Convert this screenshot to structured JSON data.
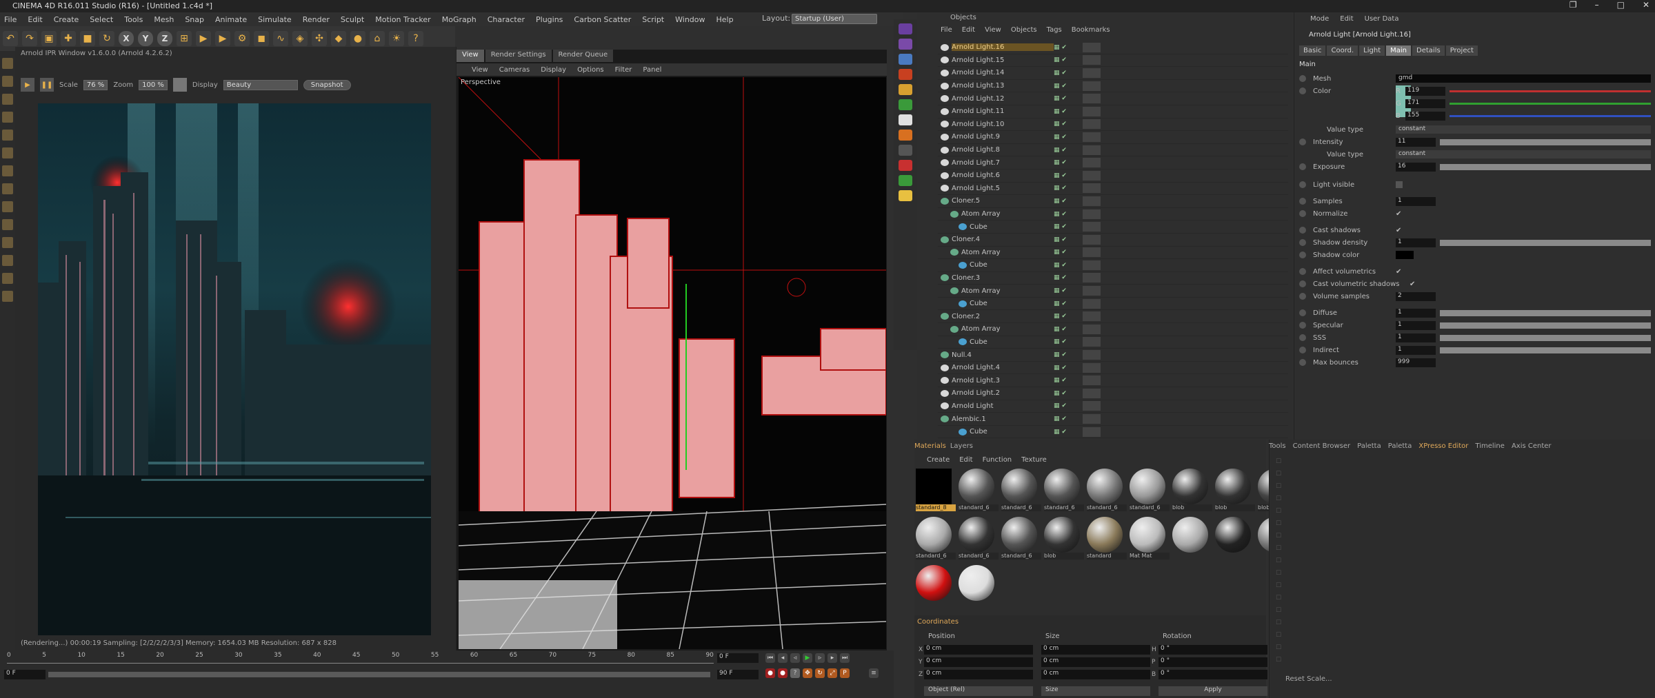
{
  "title": "CINEMA 4D R16.011 Studio (R16) - [Untitled 1.c4d *]",
  "menu": [
    "File",
    "Edit",
    "Create",
    "Select",
    "Tools",
    "Mesh",
    "Snap",
    "Animate",
    "Simulate",
    "Render",
    "Sculpt",
    "Motion Tracker",
    "MoGraph",
    "Character",
    "Plugins",
    "Carbon Scatter",
    "Script",
    "Window",
    "Help"
  ],
  "layout": {
    "label": "Layout:",
    "value": "Startup (User)"
  },
  "ipr": {
    "title": "Arnold IPR Window v1.6.0.0 (Arnold 4.2.6.2)",
    "scale_label": "Scale",
    "scale": "76 %",
    "zoom_label": "Zoom",
    "zoom": "100 %",
    "display_label": "Display",
    "display": "Beauty",
    "snapshot": "Snapshot",
    "status": "(Rendering...) 00:00:19   Sampling: [2/2/2/2/3/3]   Memory: 1654.03 MB   Resolution: 687 x 828"
  },
  "viewport": {
    "tabs": [
      "View",
      "Render Settings",
      "Render Queue"
    ],
    "menu": [
      "View",
      "Cameras",
      "Display",
      "Options",
      "Filter",
      "Panel"
    ],
    "label": "Perspective"
  },
  "objects": {
    "title": "Objects",
    "menu": [
      "File",
      "Edit",
      "View",
      "Objects",
      "Tags",
      "Bookmarks"
    ],
    "rows": [
      "Arnold Light.16",
      "Arnold Light.15",
      "Arnold Light.14",
      "Arnold Light.13",
      "Arnold Light.12",
      "Arnold Light.11",
      "Arnold Light.10",
      "Arnold Light.9",
      "Arnold Light.8",
      "Arnold Light.7",
      "Arnold Light.6",
      "Arnold Light.5",
      "Cloner.5",
      "Atom Array",
      "Cube",
      "Cloner.4",
      "Atom Array",
      "Cube",
      "Cloner.3",
      "Atom Array",
      "Cube",
      "Cloner.2",
      "Atom Array",
      "Cube",
      "Null.4",
      "Arnold Light.4",
      "Arnold Light.3",
      "Arnold Light.2",
      "Arnold Light",
      "Alembic.1",
      "Cube"
    ]
  },
  "attributes": {
    "menu": [
      "Mode",
      "Edit",
      "User Data"
    ],
    "title": "Arnold Light [Arnold Light.16]",
    "tabs": [
      "Basic",
      "Coord.",
      "Light",
      "Main",
      "Details",
      "Project"
    ],
    "section": "Main",
    "mesh_label": "Mesh",
    "mesh_value": "gmd",
    "color_label": "Color",
    "color_swatch": "#7fbfb0",
    "rgb": [
      {
        "k": "R",
        "v": "119"
      },
      {
        "k": "G",
        "v": "171"
      },
      {
        "k": "B",
        "v": "155"
      }
    ],
    "value_type_label": "Value type",
    "value_type": "constant",
    "intensity_label": "Intensity",
    "intensity": "11",
    "exposure_label": "Exposure",
    "exposure": "16",
    "light_visible": "Light visible",
    "samples_label": "Samples",
    "samples": "1",
    "normalize": "Normalize",
    "cast_shadows": "Cast shadows",
    "shadow_density_label": "Shadow density",
    "shadow_density": "1",
    "shadow_color": "Shadow color",
    "affect_vol": "Affect volumetrics",
    "cast_vol_shadows": "Cast volumetric shadows",
    "vol_samples_label": "Volume samples",
    "vol_samples": "2",
    "diffuse_label": "Diffuse",
    "diffuse": "1",
    "specular_label": "Specular",
    "specular": "1",
    "sss_label": "SSS",
    "sss": "1",
    "indirect_label": "Indirect",
    "indirect": "1",
    "max_bounces_label": "Max bounces",
    "max_bounces": "999"
  },
  "materials": {
    "tabs": [
      "Materials",
      "Layers"
    ],
    "menu": [
      "Create",
      "Edit",
      "Function",
      "Texture"
    ],
    "items": [
      "standard_8",
      "standard_6",
      "standard_6",
      "standard_6",
      "standard_6",
      "standard_6",
      "blob",
      "blob",
      "blob.1",
      "standard_6",
      "standard_6",
      "standard_6",
      "blob",
      "standard",
      "Mat Mat",
      "",
      "",
      "",
      "",
      ""
    ]
  },
  "coordinates": {
    "title": "Coordinates",
    "cols": [
      "Position",
      "Size",
      "Rotation"
    ],
    "pos": [
      "0 cm",
      "0 cm",
      "0 cm"
    ],
    "size": [
      "0 cm",
      "0 cm",
      "0 cm"
    ],
    "rot": [
      "0 °",
      "0 °",
      "0 °"
    ],
    "axes": [
      "X",
      "Y",
      "Z"
    ],
    "rot_axes": [
      "H",
      "P",
      "B"
    ],
    "mode": "Object (Rel)",
    "size_mode": "Size",
    "apply": "Apply"
  },
  "content": {
    "tabs": [
      "Tools",
      "Content Browser",
      "Paletta",
      "Paletta",
      "XPresso Editor",
      "Timeline",
      "Axis Center"
    ],
    "reset": "Reset Scale..."
  },
  "timeline": {
    "ticks": [
      "0",
      "5",
      "10",
      "15",
      "20",
      "25",
      "30",
      "35",
      "40",
      "45",
      "50",
      "55",
      "60",
      "65",
      "70",
      "75",
      "80",
      "85",
      "90"
    ],
    "frame": "0 F",
    "start": "0 F",
    "end": "90 F",
    "current": "0 F",
    "maxf": "90 F"
  }
}
